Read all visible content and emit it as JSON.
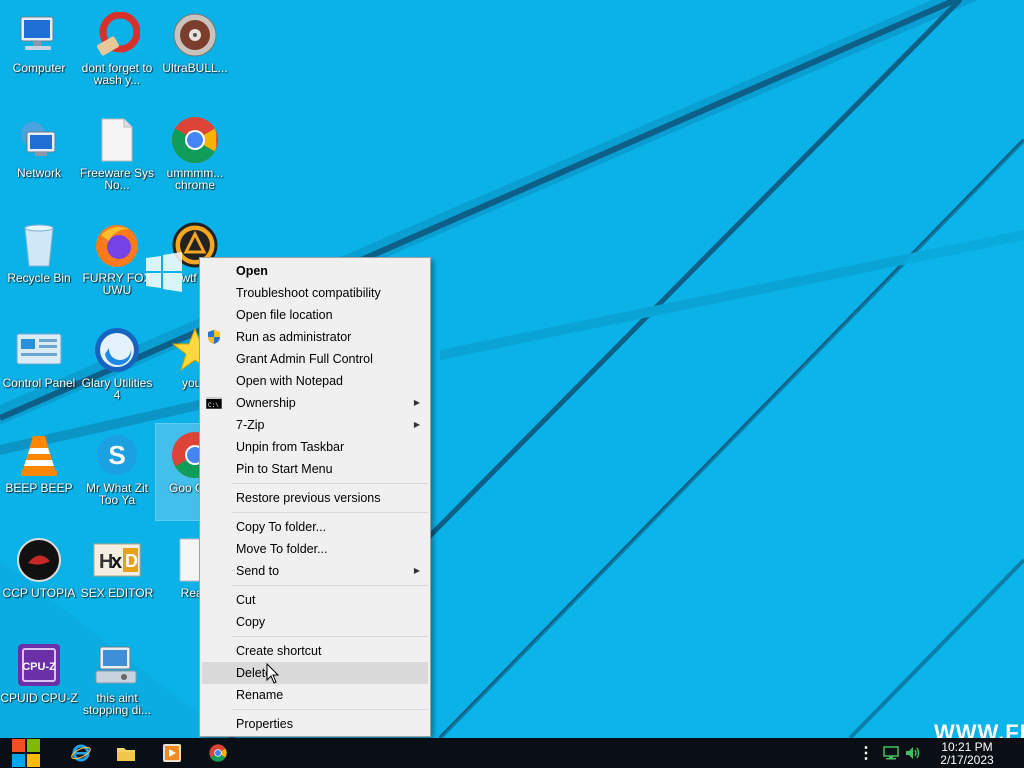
{
  "desktop": {
    "icons": [
      {
        "label": "Computer"
      },
      {
        "label": "dont forget to wash y..."
      },
      {
        "label": "UltraBULL..."
      },
      {
        "label": "Network"
      },
      {
        "label": "Freeware Sys No..."
      },
      {
        "label": "ummmm... chrome"
      },
      {
        "label": "Recycle Bin"
      },
      {
        "label": "FURRY FOX UWU"
      },
      {
        "label": "wtf is"
      },
      {
        "label": "Control Panel"
      },
      {
        "label": "Glary Utilities 4"
      },
      {
        "label": "you t"
      },
      {
        "label": "BEEP BEEP"
      },
      {
        "label": "Mr What Zit Too Ya"
      },
      {
        "label": "Goo Chro"
      },
      {
        "label": "CCP UTOPIA"
      },
      {
        "label": "SEX EDITOR"
      },
      {
        "label": "Read"
      },
      {
        "label": "CPUID CPU-Z"
      },
      {
        "label": "this aint stopping di..."
      }
    ]
  },
  "context_menu": {
    "items": [
      {
        "label": "Open"
      },
      {
        "label": "Troubleshoot compatibility"
      },
      {
        "label": "Open file location"
      },
      {
        "label": "Run as administrator"
      },
      {
        "label": "Grant Admin Full Control"
      },
      {
        "label": "Open with Notepad"
      },
      {
        "label": "Ownership"
      },
      {
        "label": "7-Zip"
      },
      {
        "label": "Unpin from Taskbar"
      },
      {
        "label": "Pin to Start Menu"
      },
      {
        "label": "Restore previous versions"
      },
      {
        "label": "Copy To folder..."
      },
      {
        "label": "Move To folder..."
      },
      {
        "label": "Send to"
      },
      {
        "label": "Cut"
      },
      {
        "label": "Copy"
      },
      {
        "label": "Create shortcut"
      },
      {
        "label": "Delete"
      },
      {
        "label": "Rename"
      },
      {
        "label": "Properties"
      }
    ],
    "hovered": "Delete",
    "submenu_indicator": "▶"
  },
  "taskbar": {
    "pinned": [
      {
        "icon": "internet-explorer-icon"
      },
      {
        "icon": "file-explorer-icon"
      },
      {
        "icon": "media-player-icon"
      },
      {
        "icon": "chrome-icon"
      }
    ],
    "clock": {
      "time": "10:21 PM",
      "date": "2/17/2023"
    },
    "tray_overflow": "⋮"
  },
  "watermark": "WWW.FR",
  "colors": {
    "wallpaper": "#0ab0e6",
    "taskbar": "#0a0f16",
    "menu_bg": "#f0f0f0",
    "menu_hover": "#d9d9d9"
  }
}
